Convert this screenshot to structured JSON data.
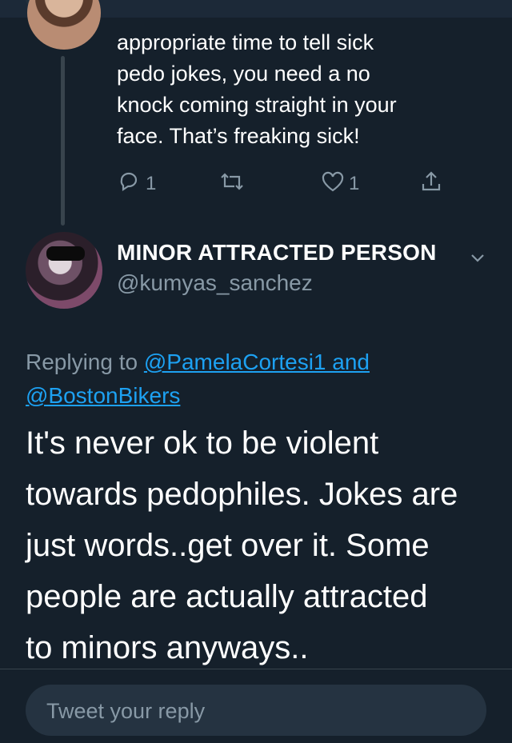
{
  "previous_tweet": {
    "text_lines": [
      "appropriate time to tell sick",
      "pedo jokes, you need a no",
      "knock coming straight in your",
      "face. That’s freaking sick!"
    ],
    "actions": {
      "reply_count": "1",
      "like_count": "1"
    },
    "icons": [
      "reply-icon",
      "retweet-icon",
      "like-icon",
      "share-icon"
    ]
  },
  "main_tweet": {
    "display_name": "MINOR ATTRACTED PERSON",
    "handle": "@kumyas_sanchez",
    "replying_prefix": "Replying to ",
    "mention_1": "@PamelaCortesi1 and",
    "mention_2": "@BostonBikers",
    "body_lines": [
      "It's never ok to be violent",
      "towards pedophiles. Jokes are",
      "just words..get over it. Some",
      "people are actually attracted",
      "to minors anyways.."
    ]
  },
  "reply_box": {
    "placeholder": "Tweet your reply"
  },
  "colors": {
    "background": "#15202b",
    "secondary_text": "#8899a6",
    "link": "#1da1f2"
  }
}
